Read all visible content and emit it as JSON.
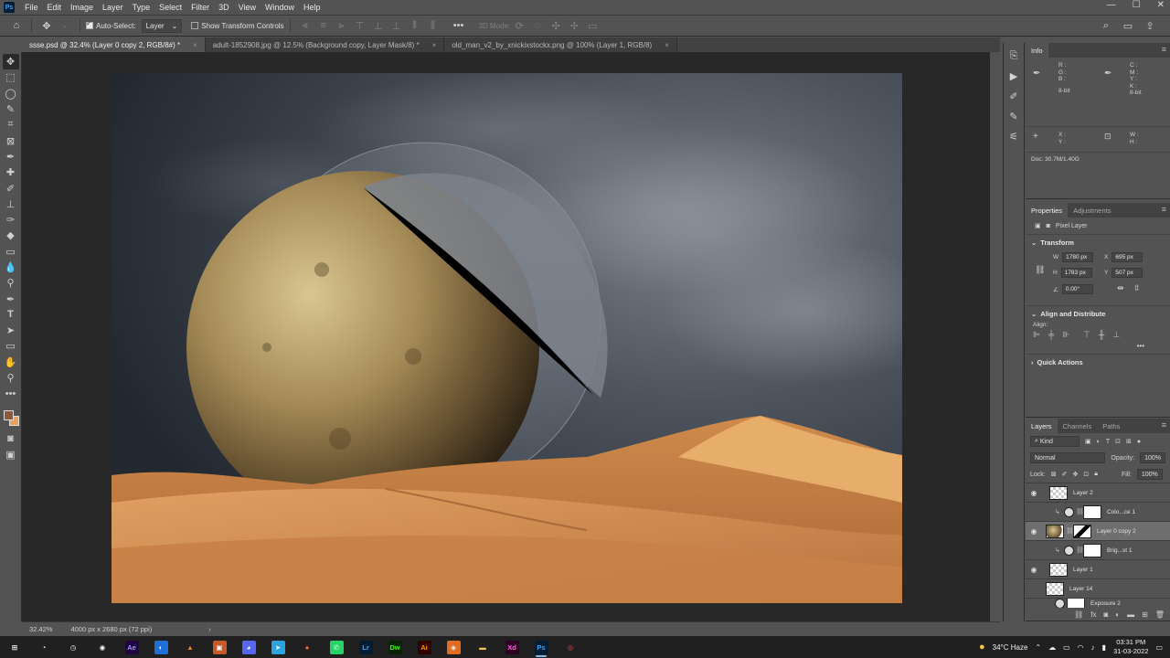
{
  "menu": {
    "logo": "Ps",
    "items": [
      "File",
      "Edit",
      "Image",
      "Layer",
      "Type",
      "Select",
      "Filter",
      "3D",
      "View",
      "Window",
      "Help"
    ],
    "window_controls": [
      "—",
      "☐",
      "✕"
    ]
  },
  "options": {
    "auto_select_label": "Auto-Select:",
    "auto_select_value": "Layer",
    "transform_controls_label": "Show Transform Controls",
    "mode_3d": "3D Mode:"
  },
  "tabs": [
    {
      "label": "ssse.psd @ 32.4% (Layer 0 copy 2, RGB/8#) *",
      "active": true
    },
    {
      "label": "adult-1852908.jpg @ 12.5% (Background copy, Layer Mask/8) *",
      "active": false
    },
    {
      "label": "old_man_v2_by_xnickixstockx.png @ 100% (Layer 1, RGB/8)",
      "active": false
    }
  ],
  "status": {
    "zoom": "32.42%",
    "doc_size": "4000 px x 2680 px (72 ppi)",
    "arrow": "›"
  },
  "info_panel": {
    "tab": "Info",
    "rgb_labels": [
      "R :",
      "G :",
      "B :"
    ],
    "cmyk_labels": [
      "C :",
      "M :",
      "Y :",
      "K :"
    ],
    "bit_left": "8-bit",
    "bit_right": "8-bit",
    "xy_labels": [
      "X :",
      "Y :"
    ],
    "wh_labels": [
      "W :",
      "H :"
    ],
    "doc": "Doc: 30.7M/1.40G"
  },
  "properties_panel": {
    "tabs": [
      "Properties",
      "Adjustments"
    ],
    "layer_type": "Pixel Layer",
    "transform_title": "Transform",
    "w_label": "W",
    "w_value": "1780 px",
    "h_label": "H",
    "h_value": "1783 px",
    "x_label": "X",
    "x_value": "695 px",
    "y_label": "Y",
    "y_value": "507 px",
    "angle_value": "0.00°",
    "align_title": "Align and Distribute",
    "align_label": "Align:",
    "more": "•••",
    "quick_actions": "Quick Actions"
  },
  "layers_panel": {
    "tabs": [
      "Layers",
      "Channels",
      "Paths"
    ],
    "filter_kind": "Kind",
    "blend_mode": "Normal",
    "opacity_label": "Opacity:",
    "opacity_value": "100%",
    "lock_label": "Lock:",
    "fill_label": "Fill:",
    "fill_value": "100%",
    "layers": [
      {
        "name": "Layer 2",
        "visible": true,
        "type": "pixel"
      },
      {
        "name": "Colo...ce 1",
        "visible": false,
        "type": "adjustment"
      },
      {
        "name": "Layer 0 copy 2",
        "visible": true,
        "type": "masked",
        "selected": true
      },
      {
        "name": "Brig...st 1",
        "visible": false,
        "type": "adjustment"
      },
      {
        "name": "Layer 1",
        "visible": true,
        "type": "pixel"
      },
      {
        "name": "Layer 14",
        "visible": false,
        "type": "pixel"
      },
      {
        "name": "Exposure 2",
        "visible": false,
        "type": "adjustment"
      }
    ]
  },
  "taskbar": {
    "apps": [
      {
        "name": "start",
        "glyph": "⊞",
        "bg": "#202020",
        "fg": "#ffffff"
      },
      {
        "name": "task-view",
        "glyph": "◔",
        "bg": "#202020",
        "fg": "#ffffff"
      },
      {
        "name": "app-clock",
        "glyph": "◷",
        "bg": "#202020",
        "fg": "#ffffff"
      },
      {
        "name": "app-camera",
        "glyph": "◉",
        "bg": "#202020",
        "fg": "#ffffff"
      },
      {
        "name": "after-effects",
        "glyph": "Ae",
        "bg": "#1f0640",
        "fg": "#9999ff"
      },
      {
        "name": "app-blue",
        "glyph": "◐",
        "bg": "#1e6fd6",
        "fg": "#ffffff"
      },
      {
        "name": "vlc",
        "glyph": "▲",
        "bg": "#202020",
        "fg": "#ff8800"
      },
      {
        "name": "app-photo",
        "glyph": "▣",
        "bg": "#c85a2a",
        "fg": "#ffffff"
      },
      {
        "name": "discord",
        "glyph": "◕",
        "bg": "#5865f2",
        "fg": "#ffffff"
      },
      {
        "name": "telegram",
        "glyph": "➤",
        "bg": "#2aa3df",
        "fg": "#ffffff"
      },
      {
        "name": "firefox",
        "glyph": "●",
        "bg": "#202020",
        "fg": "#ff7139"
      },
      {
        "name": "whatsapp",
        "glyph": "✆",
        "bg": "#25d366",
        "fg": "#ffffff"
      },
      {
        "name": "lightroom",
        "glyph": "Lr",
        "bg": "#001d34",
        "fg": "#31a8ff"
      },
      {
        "name": "dreamweaver",
        "glyph": "Dw",
        "bg": "#072401",
        "fg": "#35fa00"
      },
      {
        "name": "illustrator",
        "glyph": "Ai",
        "bg": "#330000",
        "fg": "#ff9a00"
      },
      {
        "name": "app-orange",
        "glyph": "◈",
        "bg": "#e06b24",
        "fg": "#ffffff"
      },
      {
        "name": "file-explorer",
        "glyph": "▬",
        "bg": "#202020",
        "fg": "#f8c64c"
      },
      {
        "name": "xd",
        "glyph": "Xd",
        "bg": "#2e001f",
        "fg": "#ff61f6"
      },
      {
        "name": "photoshop",
        "glyph": "Ps",
        "bg": "#001e36",
        "fg": "#31a8ff",
        "active": true
      },
      {
        "name": "chrome",
        "glyph": "◎",
        "bg": "#202020",
        "fg": "#e8453c"
      }
    ],
    "weather": "34°C  Haze",
    "time": "03:31 PM",
    "date": "31-03-2022"
  }
}
